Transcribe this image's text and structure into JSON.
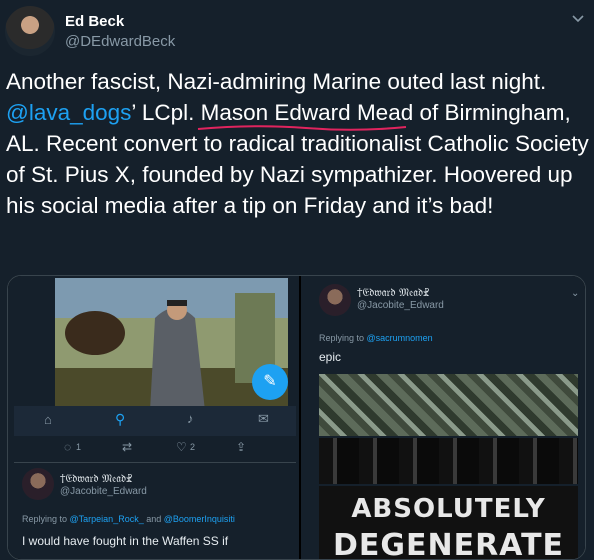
{
  "author": {
    "name": "Ed Beck",
    "handle": "@DEdwardBeck"
  },
  "tweet": {
    "part1": "Another fascist, Nazi-admiring Marine outed last night. ",
    "mention": "@lava_dogs",
    "part2": "’ LCpl. Mason Edward Mead of Birmingham, AL. Recent convert to radical traditionalist Catholic Society of St. Pius X, founded by Nazi sympathizer. Hoovered up his social media after a tip on Friday and it’s bad!"
  },
  "left_screenshot": {
    "counts": {
      "replies": "1",
      "likes": "2"
    },
    "reply": {
      "display_name": "†𝔈𝔡𝔴𝔞𝔯𝔡 𝔐𝔢𝔞𝔡☧",
      "handle": "@Jacobite_Edward",
      "replying_prefix": "Replying to ",
      "replying_to_1": "@Tarpeian_Rock_",
      "replying_and": " and ",
      "replying_to_2": "@BoomerInquisiti",
      "text": "I would have fought in the Waffen SS if"
    }
  },
  "right_screenshot": {
    "display_name": "†𝔈𝔡𝔴𝔞𝔯𝔡 𝔐𝔢𝔞𝔡☧",
    "handle": "@Jacobite_Edward",
    "replying_prefix": "Replying to ",
    "replying_to": "@sacrumnomen",
    "text": "epic",
    "meme_line1": "ABSOLUTELY",
    "meme_line2": "DEGENERATE"
  },
  "colors": {
    "background": "#15202b",
    "link": "#1da1f2",
    "muted": "#8899a6",
    "underline": "#e0245e"
  }
}
